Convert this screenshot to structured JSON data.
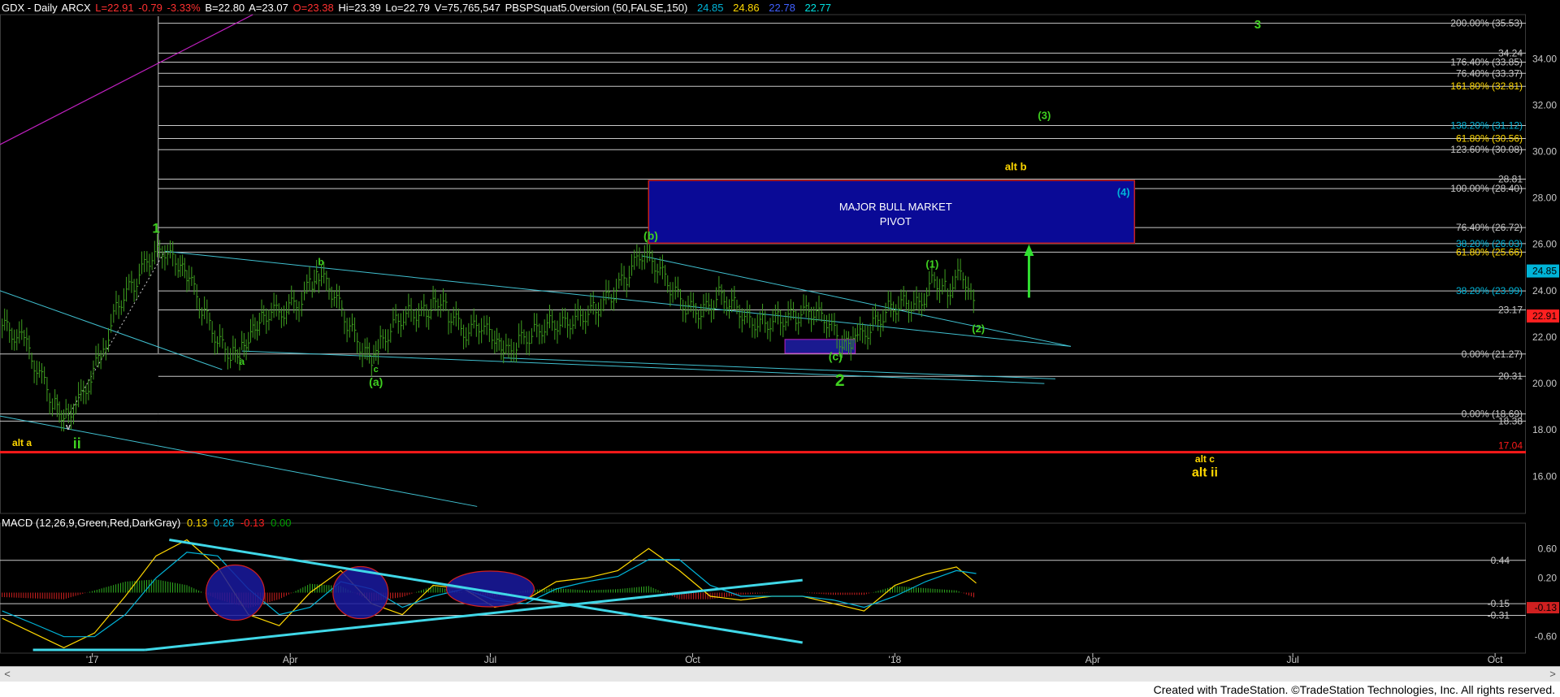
{
  "header": {
    "title": "GDX - Daily",
    "exchange": "ARCX",
    "last": "L=22.91",
    "change": "-0.79",
    "pct": "-3.33%",
    "bid": "B=22.80",
    "ask": "A=23.07",
    "open": "O=23.38",
    "high": "Hi=23.39",
    "low": "Lo=22.79",
    "volume": "V=75,765,547",
    "indicator": "PBSPSquat5.0version (50,FALSE,150)",
    "ind_values": [
      "24.85",
      "24.86",
      "22.78",
      "22.77"
    ],
    "ind_colors": [
      "#00b4d8",
      "#ffd800",
      "#4060ff",
      "#00e0e0"
    ]
  },
  "macd_header": {
    "label": "MACD (12,26,9,Green,Red,DarkGray)",
    "values": [
      "0.13",
      "0.26",
      "-0.13",
      "0.00"
    ],
    "colors": [
      "#ffd800",
      "#00b4d8",
      "#ff2020",
      "#00a000"
    ]
  },
  "pivot_box": {
    "line1": "MAJOR BULL MARKET",
    "line2": "PIVOT",
    "low": 26.05,
    "high": 28.75
  },
  "footer": {
    "text": "Created with TradeStation. ©TradeStation Technologies, Inc. All rights reserved."
  },
  "scrollbar": {
    "left_arrow": "<",
    "right_arrow": ">"
  },
  "chart_data": [
    {
      "type": "line",
      "chart": "price",
      "ylim": [
        14.4,
        35.9
      ],
      "y_ticks": [
        16,
        18,
        20,
        22,
        24,
        26,
        28,
        30,
        32,
        34
      ],
      "x_labels": [
        "'17",
        "Apr",
        "Jul",
        "Oct",
        "'18",
        "Apr",
        "Jul",
        "Oct"
      ],
      "x_label_dates": [
        "2017-01-01",
        "2017-04-01",
        "2017-07-01",
        "2017-10-01",
        "2018-01-01",
        "2018-04-01",
        "2018-07-01",
        "2018-10-01"
      ],
      "x_range": [
        "2016-11-20",
        "2018-10-15"
      ],
      "series": [
        {
          "color": "#3fa020",
          "x": [
            "2016-11-21",
            "2016-12-01",
            "2016-12-09",
            "2016-12-15",
            "2016-12-20",
            "2016-12-28",
            "2017-01-06",
            "2017-01-13",
            "2017-01-20",
            "2017-01-27",
            "2017-02-03",
            "2017-02-09",
            "2017-02-14",
            "2017-02-21",
            "2017-02-28",
            "2017-03-06",
            "2017-03-10",
            "2017-03-15",
            "2017-03-20",
            "2017-03-28",
            "2017-04-05",
            "2017-04-11",
            "2017-04-14",
            "2017-04-21",
            "2017-04-28",
            "2017-05-05",
            "2017-05-09",
            "2017-05-12",
            "2017-05-19",
            "2017-05-26",
            "2017-06-02",
            "2017-06-06",
            "2017-06-12",
            "2017-06-20",
            "2017-06-27",
            "2017-07-03",
            "2017-07-07",
            "2017-07-14",
            "2017-07-21",
            "2017-07-28",
            "2017-08-04",
            "2017-08-11",
            "2017-08-18",
            "2017-08-25",
            "2017-09-01",
            "2017-09-08",
            "2017-09-15",
            "2017-09-22",
            "2017-09-29",
            "2017-10-06",
            "2017-10-13",
            "2017-10-20",
            "2017-10-27",
            "2017-11-03",
            "2017-11-10",
            "2017-11-17",
            "2017-11-24",
            "2017-12-01",
            "2017-12-08",
            "2017-12-12",
            "2017-12-15",
            "2017-12-22",
            "2017-12-29",
            "2018-01-05",
            "2018-01-12",
            "2018-01-19",
            "2018-01-25",
            "2018-02-01",
            "2018-02-07"
          ],
          "values": [
            22.5,
            21.8,
            20.2,
            19.0,
            18.6,
            19.5,
            21.5,
            23.5,
            24.3,
            25.4,
            25.7,
            25.0,
            24.5,
            23.0,
            21.7,
            21.2,
            21.5,
            22.4,
            23.0,
            23.1,
            23.5,
            24.4,
            24.7,
            23.8,
            22.4,
            21.3,
            20.9,
            21.7,
            22.7,
            23.1,
            23.0,
            23.8,
            23.0,
            22.2,
            22.5,
            21.8,
            21.2,
            21.8,
            22.2,
            22.6,
            22.6,
            22.9,
            23.2,
            23.8,
            24.6,
            25.6,
            25.0,
            24.0,
            23.2,
            23.1,
            23.8,
            23.4,
            22.7,
            22.6,
            22.8,
            22.9,
            23.1,
            22.7,
            21.7,
            21.5,
            21.9,
            22.5,
            23.2,
            23.5,
            23.4,
            24.5,
            24.0,
            24.8,
            22.9
          ]
        }
      ]
    },
    {
      "type": "line",
      "chart": "macd",
      "ylim": [
        -0.78,
        0.88
      ],
      "y_ticks": [
        "0.60",
        "0.20",
        "-0.60"
      ],
      "series": [
        {
          "name": "MACD",
          "color": "#ffd800",
          "x": [
            "2016-11-21",
            "2016-12-05",
            "2016-12-19",
            "2017-01-02",
            "2017-01-16",
            "2017-01-30",
            "2017-02-13",
            "2017-02-27",
            "2017-03-13",
            "2017-03-27",
            "2017-04-10",
            "2017-04-24",
            "2017-05-08",
            "2017-05-22",
            "2017-06-05",
            "2017-06-19",
            "2017-07-03",
            "2017-07-17",
            "2017-07-31",
            "2017-08-14",
            "2017-08-28",
            "2017-09-11",
            "2017-09-25",
            "2017-10-09",
            "2017-10-23",
            "2017-11-06",
            "2017-11-20",
            "2017-12-04",
            "2017-12-18",
            "2018-01-01",
            "2018-01-15",
            "2018-01-29",
            "2018-02-07"
          ],
          "values": [
            -0.35,
            -0.55,
            -0.75,
            -0.55,
            -0.05,
            0.5,
            0.72,
            0.35,
            -0.3,
            -0.45,
            0.0,
            0.3,
            -0.15,
            -0.3,
            0.1,
            0.05,
            -0.2,
            -0.1,
            0.15,
            0.2,
            0.3,
            0.6,
            0.3,
            -0.05,
            -0.1,
            -0.05,
            -0.05,
            -0.15,
            -0.25,
            0.1,
            0.25,
            0.35,
            0.13
          ]
        },
        {
          "name": "Avg",
          "color": "#00b4d8",
          "x": [
            "2016-11-21",
            "2016-12-05",
            "2016-12-19",
            "2017-01-02",
            "2017-01-16",
            "2017-01-30",
            "2017-02-13",
            "2017-02-27",
            "2017-03-13",
            "2017-03-27",
            "2017-04-10",
            "2017-04-24",
            "2017-05-08",
            "2017-05-22",
            "2017-06-05",
            "2017-06-19",
            "2017-07-03",
            "2017-07-17",
            "2017-07-31",
            "2017-08-14",
            "2017-08-28",
            "2017-09-11",
            "2017-09-25",
            "2017-10-09",
            "2017-10-23",
            "2017-11-06",
            "2017-11-20",
            "2017-12-04",
            "2017-12-18",
            "2018-01-01",
            "2018-01-15",
            "2018-01-29",
            "2018-02-07"
          ],
          "values": [
            -0.25,
            -0.42,
            -0.6,
            -0.6,
            -0.3,
            0.2,
            0.55,
            0.5,
            0.05,
            -0.3,
            -0.2,
            0.15,
            0.05,
            -0.2,
            -0.05,
            0.05,
            -0.1,
            -0.15,
            0.05,
            0.15,
            0.22,
            0.45,
            0.45,
            0.1,
            -0.05,
            -0.05,
            -0.05,
            -0.1,
            -0.2,
            -0.05,
            0.15,
            0.3,
            0.26
          ]
        }
      ],
      "level_lines": [
        {
          "label": "0.44",
          "value": 0.44
        },
        {
          "label": "-0.15",
          "value": -0.15
        },
        {
          "label": "-0.31",
          "value": -0.31
        }
      ],
      "last_label": "-0.13"
    }
  ],
  "price_levels": [
    {
      "label": "200.00% (35.53)",
      "value": 35.53,
      "color": "#c8c8c8"
    },
    {
      "label": "34.24",
      "value": 34.24,
      "color": "#c8c8c8"
    },
    {
      "label": "176.40% (33.85)",
      "value": 33.85,
      "color": "#c8c8c8"
    },
    {
      "label": "76.40% (33.37)",
      "value": 33.37,
      "color": "#c8c8c8"
    },
    {
      "label": "161.80% (32.81)",
      "value": 32.81,
      "color": "#ffd800"
    },
    {
      "label": "138.20% (31.12)",
      "value": 31.12,
      "color": "#00b4d8"
    },
    {
      "label": "61.80% (30.56)",
      "value": 30.56,
      "color": "#ffd800"
    },
    {
      "label": "123.60% (30.08)",
      "value": 30.08,
      "color": "#c8c8c8"
    },
    {
      "label": "28.81",
      "value": 28.81,
      "color": "#c8c8c8"
    },
    {
      "label": "100.00% (28.40)",
      "value": 28.4,
      "color": "#c8c8c8"
    },
    {
      "label": "76.40% (26.72)",
      "value": 26.72,
      "color": "#c8c8c8"
    },
    {
      "label": "38.20% (26.03)",
      "value": 26.03,
      "color": "#00b4d8"
    },
    {
      "label": "61.80% (25.66)",
      "value": 25.66,
      "color": "#ffd800"
    },
    {
      "label": "38.20% (23.99)",
      "value": 23.99,
      "color": "#00b4d8"
    },
    {
      "label": "23.17",
      "value": 23.17,
      "color": "#c8c8c8"
    },
    {
      "label": "0.00% (21.27)",
      "value": 21.27,
      "color": "#c8c8c8"
    },
    {
      "label": "20.31",
      "value": 20.31,
      "color": "#c8c8c8"
    },
    {
      "label": "0.00% (18.69)",
      "value": 18.69,
      "color": "#c8c8c8"
    },
    {
      "label": "18.38",
      "value": 18.38,
      "color": "#c8c8c8"
    }
  ],
  "support_line": {
    "label": "17.04",
    "value": 17.04,
    "color": "#ff1a1a"
  },
  "last_price_tags": [
    {
      "label": "24.85",
      "value": 24.85,
      "color": "#00b4d8"
    },
    {
      "label": "22.91",
      "value": 22.91,
      "color": "#ff2020"
    }
  ],
  "wave_labels": [
    {
      "text": "3",
      "date": "2018-06-15",
      "value": 35.3,
      "color": "#3fd020",
      "size": 15
    },
    {
      "text": "(3)",
      "date": "2018-03-10",
      "value": 31.4,
      "color": "#3fd020",
      "size": 13
    },
    {
      "text": "alt b",
      "date": "2018-02-25",
      "value": 29.2,
      "color": "#ffd800",
      "size": 13
    },
    {
      "text": "(4)",
      "date": "2018-04-15",
      "value": 28.1,
      "color": "#00b4d8",
      "size": 13
    },
    {
      "text": "1",
      "date": "2017-01-30",
      "value": 26.5,
      "color": "#3fd020",
      "size": 17
    },
    {
      "text": "(b)",
      "date": "2017-09-12",
      "value": 26.2,
      "color": "#3fd020",
      "size": 14
    },
    {
      "text": "b",
      "date": "2017-04-15",
      "value": 25.1,
      "color": "#3fd020",
      "size": 12
    },
    {
      "text": "(1)",
      "date": "2018-01-18",
      "value": 25.0,
      "color": "#3fd020",
      "size": 13
    },
    {
      "text": "(2)",
      "date": "2018-02-08",
      "value": 22.2,
      "color": "#3fd020",
      "size": 13
    },
    {
      "text": "a",
      "date": "2017-03-10",
      "value": 20.8,
      "color": "#3fd020",
      "size": 12
    },
    {
      "text": "c",
      "date": "2017-05-10",
      "value": 20.5,
      "color": "#3fd020",
      "size": 11
    },
    {
      "text": "(a)",
      "date": "2017-05-10",
      "value": 19.9,
      "color": "#3fd020",
      "size": 14
    },
    {
      "text": "(c)",
      "date": "2017-12-05",
      "value": 21.0,
      "color": "#3fd020",
      "size": 14
    },
    {
      "text": "2",
      "date": "2017-12-07",
      "value": 19.9,
      "color": "#3fd020",
      "size": 21
    },
    {
      "text": "v",
      "date": "2016-12-21",
      "value": 18.0,
      "color": "#c8c8c8",
      "size": 11
    },
    {
      "text": "ii",
      "date": "2016-12-25",
      "value": 17.2,
      "color": "#3fd020",
      "size": 18
    },
    {
      "text": "alt a",
      "date": "2016-11-30",
      "value": 17.3,
      "color": "#ffd800",
      "size": 12
    },
    {
      "text": "alt c",
      "date": "2018-05-22",
      "value": 16.6,
      "color": "#ffd800",
      "size": 12
    },
    {
      "text": "alt ii",
      "date": "2018-05-22",
      "value": 16.0,
      "color": "#ffd800",
      "size": 16
    }
  ]
}
